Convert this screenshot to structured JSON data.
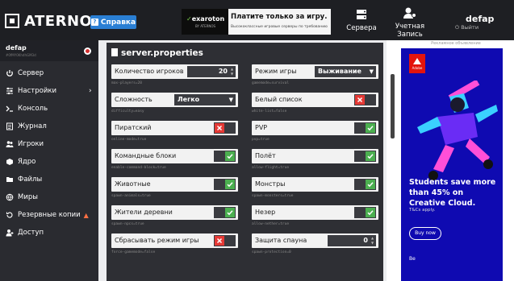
{
  "header": {
    "brand": "ATERNOS",
    "help_label": "Справка",
    "ad": {
      "logo_main": "exaroton",
      "logo_sub": "BY ATERNOS",
      "headline": "Платите только за игру.",
      "subline": "Высококлассные игровые серверы по требованию"
    },
    "nav": {
      "servers": "Сервера",
      "account_line1": "Учетная",
      "account_line2": "Запись"
    },
    "user": "defap",
    "logout": "Выйти"
  },
  "sidebar": {
    "user": "defap",
    "server_id": "#0fMY0KhdhGM3d",
    "items": [
      {
        "label": "Сервер",
        "icon": "power-icon"
      },
      {
        "label": "Настройки",
        "icon": "sliders-icon"
      },
      {
        "label": "Консоль",
        "icon": "console-icon"
      },
      {
        "label": "Журнал",
        "icon": "log-icon"
      },
      {
        "label": "Игроки",
        "icon": "users-icon"
      },
      {
        "label": "Ядро",
        "icon": "core-icon"
      },
      {
        "label": "Файлы",
        "icon": "folder-icon"
      },
      {
        "label": "Миры",
        "icon": "globe-icon"
      },
      {
        "label": "Резервные копии",
        "icon": "backup-icon"
      },
      {
        "label": "Доступ",
        "icon": "access-icon"
      }
    ]
  },
  "properties": {
    "title": "server.properties",
    "left": [
      {
        "label": "Количество игроков",
        "key": "max-players=20",
        "type": "number",
        "value": "20"
      },
      {
        "label": "Сложность",
        "key": "difficulty=easy",
        "type": "select",
        "value": "Легко"
      },
      {
        "label": "Пиратский",
        "key": "online-mode=true",
        "type": "toggle",
        "value": "off"
      },
      {
        "label": "Командные блоки",
        "key": "enable-command-block=true",
        "type": "toggle",
        "value": "on"
      },
      {
        "label": "Животные",
        "key": "spawn-animals=true",
        "type": "toggle",
        "value": "on"
      },
      {
        "label": "Жители деревни",
        "key": "spawn-npcs=true",
        "type": "toggle",
        "value": "on"
      },
      {
        "label": "Сбрасывать режим игры",
        "key": "force-gamemode=false",
        "type": "toggle",
        "value": "off"
      }
    ],
    "right": [
      {
        "label": "Режим игры",
        "key": "gamemode=survival",
        "type": "select",
        "value": "Выживание"
      },
      {
        "label": "Белый список",
        "key": "white-list=false",
        "type": "toggle",
        "value": "off"
      },
      {
        "label": "PVP",
        "key": "pvp=true",
        "type": "toggle",
        "value": "on"
      },
      {
        "label": "Полёт",
        "key": "allow-flight=true",
        "type": "toggle",
        "value": "on"
      },
      {
        "label": "Монстры",
        "key": "spawn-monsters=true",
        "type": "toggle",
        "value": "on"
      },
      {
        "label": "Незер",
        "key": "allow-nether=true",
        "type": "toggle",
        "value": "on"
      },
      {
        "label": "Защита спауна",
        "key": "spawn-protection=0",
        "type": "number",
        "value": "0"
      }
    ]
  },
  "right_ad": {
    "caption": "Рекламное объявление",
    "brand": "Adobe",
    "headline": "Students save more than 45% on Creative Cloud.",
    "terms": "T&Cs apply.",
    "cta": "Buy now",
    "bottom": "Be"
  },
  "colors": {
    "topbar": "#1e1f23",
    "sidebar": "#2a2b30",
    "panel": "#2e2f34",
    "toggle_on": "#4caf50",
    "toggle_off": "#e53935",
    "help": "#2a7fd4",
    "ad_bg": "#0f0ab1"
  }
}
